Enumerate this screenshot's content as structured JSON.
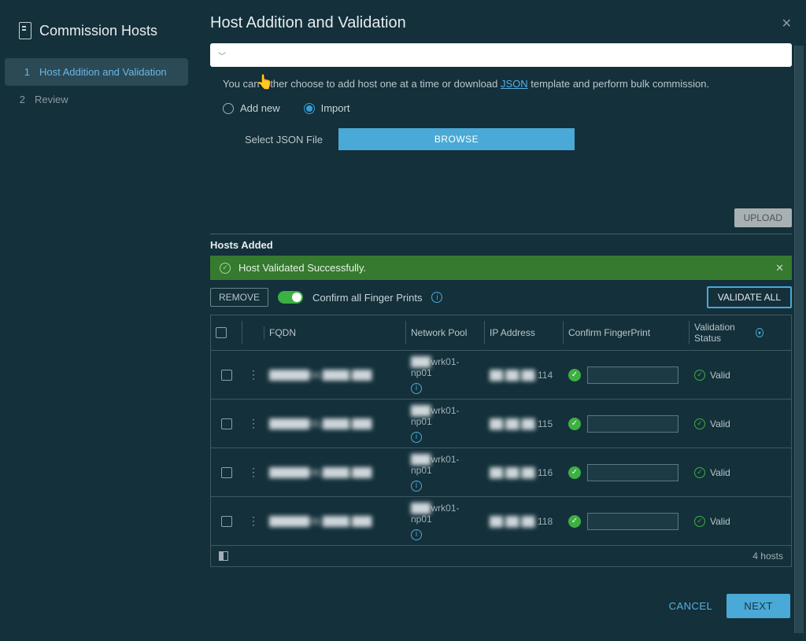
{
  "sidebar": {
    "title": "Commission Hosts",
    "steps": [
      {
        "num": "1",
        "label": "Host Addition and Validation",
        "active": true
      },
      {
        "num": "2",
        "label": "Review",
        "active": false
      }
    ]
  },
  "header": {
    "title": "Host Addition and Validation"
  },
  "description": {
    "pre": "You can either choose to add host one at a time or download ",
    "link": "JSON",
    "post": " template and perform bulk commission."
  },
  "mode": {
    "add_new": "Add new",
    "import": "Import",
    "selected": "import"
  },
  "file": {
    "label": "Select JSON File",
    "browse": "BROWSE"
  },
  "upload": {
    "label": "UPLOAD"
  },
  "hosts_added_heading": "Hosts Added",
  "success": {
    "message": "Host Validated Successfully."
  },
  "toolbar": {
    "remove": "REMOVE",
    "confirm_label": "Confirm all Finger Prints",
    "validate_all": "VALIDATE ALL"
  },
  "table": {
    "headers": {
      "fqdn": "FQDN",
      "pool": "Network Pool",
      "ip": "IP Address",
      "fp": "Confirm FingerPrint",
      "status": "Validation Status"
    },
    "rows": [
      {
        "fqdn": "██████04.████.███",
        "pool_suffix": "wrk01-np01",
        "ip_suffix": "114",
        "status": "Valid"
      },
      {
        "fqdn": "██████05.████.███",
        "pool_suffix": "wrk01-np01",
        "ip_suffix": "115",
        "status": "Valid"
      },
      {
        "fqdn": "██████06.████.███",
        "pool_suffix": "wrk01-np01",
        "ip_suffix": "116",
        "status": "Valid"
      },
      {
        "fqdn": "██████08.████.███",
        "pool_suffix": "wrk01-np01",
        "ip_suffix": "118",
        "status": "Valid"
      }
    ],
    "footer_count": "4 hosts"
  },
  "footer": {
    "cancel": "CANCEL",
    "next": "NEXT"
  }
}
